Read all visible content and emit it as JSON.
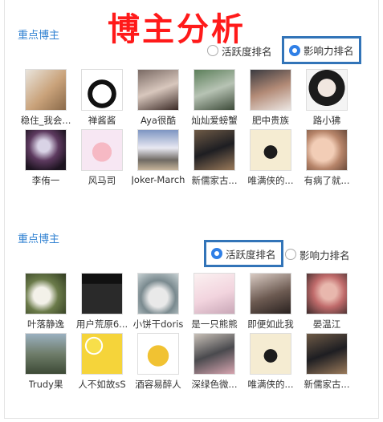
{
  "title": "博主分析",
  "sections": [
    {
      "label": "重点博主",
      "radios": [
        {
          "label": "活跃度排名",
          "checked": false
        },
        {
          "label": "影响力排名",
          "checked": true
        }
      ],
      "bloggers": [
        {
          "name": "稳住_我会...",
          "bg": "linear-gradient(135deg,#e9e4dc,#c9a27a 55%,#8a6a4a)"
        },
        {
          "name": "禅酱酱",
          "bg": "radial-gradient(circle at 50% 60%,#fff 0 30%,#111 31% 45%,#fff 46%),#c0232b"
        },
        {
          "name": "Aya很酷",
          "bg": "linear-gradient(160deg,#7a6a64,#d8c7bd 50%,#3b2a26)"
        },
        {
          "name": "灿灿爱螃蟹",
          "bg": "linear-gradient(160deg,#5c7f5a,#b7c3b4 50%,#3d4b39)"
        },
        {
          "name": "肥中贵族",
          "bg": "linear-gradient(160deg,#3b3b40,#b28a76 50%,#ece6e2)"
        },
        {
          "name": "路小狒",
          "bg": "radial-gradient(circle at 50% 45%,#f1e7e0 0 30%,#1b1b1b 31% 60%,#f4f4f4 61%)"
        },
        {
          "name": "李侑一",
          "bg": "radial-gradient(circle at 45% 40%,#d9d3e6 0 18%,#5d3a5f 45%,#1d1420 80%)"
        },
        {
          "name": "风马司",
          "bg": "radial-gradient(circle at 50% 55%,#f6b9c4 0 32%,#f7e7f3 33%)"
        },
        {
          "name": "Joker-March",
          "bg": "linear-gradient(180deg,#7d95c2,#e9e9f2 45%,#6f6a63 75%,#c7b49a)"
        },
        {
          "name": "新儒家古...",
          "bg": "linear-gradient(160deg,#6e5a46,#1e1e22 50%,#9a7a5a)"
        },
        {
          "name": "唯满侠的...",
          "bg": "radial-gradient(circle at 50% 55%,#1c1c1c 0 22%,#f5ecd2 23%)"
        },
        {
          "name": "有病了就...",
          "bg": "radial-gradient(circle at 40% 50%,#f2cdb6 0 35%,#b7856a 60%,#6b4b3b)"
        }
      ]
    },
    {
      "label": "重点博主",
      "radios": [
        {
          "label": "活跃度排名",
          "checked": true
        },
        {
          "label": "影响力排名",
          "checked": false
        }
      ],
      "bloggers": [
        {
          "name": "叶落静逸",
          "bg": "radial-gradient(circle at 40% 55%,#f3f1e9 0 25%,#6b7b4a 50%,#2f3a1f)"
        },
        {
          "name": "用户荒原6...",
          "bg": "linear-gradient(180deg,#111 0 25%,#2a2a2a 26% 100%)"
        },
        {
          "name": "小饼干doris",
          "bg": "radial-gradient(circle at 50% 60%,#e9e9e9 0 30%,#7a8a8f 55%,#c8d2d4)"
        },
        {
          "name": "是一只熊熊",
          "bg": "linear-gradient(160deg,#fbf1f1,#f2d4de 55%,#c9a7b7)"
        },
        {
          "name": "即便如此我",
          "bg": "linear-gradient(160deg,#d9cbc3,#6c5a51 55%,#2a2220)"
        },
        {
          "name": "晏温江",
          "bg": "radial-gradient(circle at 55% 45%,#e8b7ad 0 25%,#c06b6b 50%,#3a2a2a)"
        },
        {
          "name": "Trudy果",
          "bg": "linear-gradient(180deg,#9ab0c0,#6f7d6a 50%,#3d4a36)"
        },
        {
          "name": "人不如故sS",
          "bg": "radial-gradient(circle at 30% 30%,#f7df4a 0 18%,#fff 19% 22%,#f5d43a 23%)"
        },
        {
          "name": "酒容易醉人",
          "bg": "radial-gradient(circle at 50% 55%,#f1c232 0 35%,#ffffff 36%)"
        },
        {
          "name": "深绿色微...",
          "bg": "linear-gradient(160deg,#c9c1b8,#4a4a4e 50%,#d7a5b0)"
        },
        {
          "name": "唯满侠的...",
          "bg": "radial-gradient(circle at 50% 55%,#1c1c1c 0 22%,#f5ecd2 23%)"
        },
        {
          "name": "新儒家古...",
          "bg": "linear-gradient(160deg,#6e5a46,#1e1e22 50%,#9a7a5a)"
        }
      ]
    }
  ]
}
